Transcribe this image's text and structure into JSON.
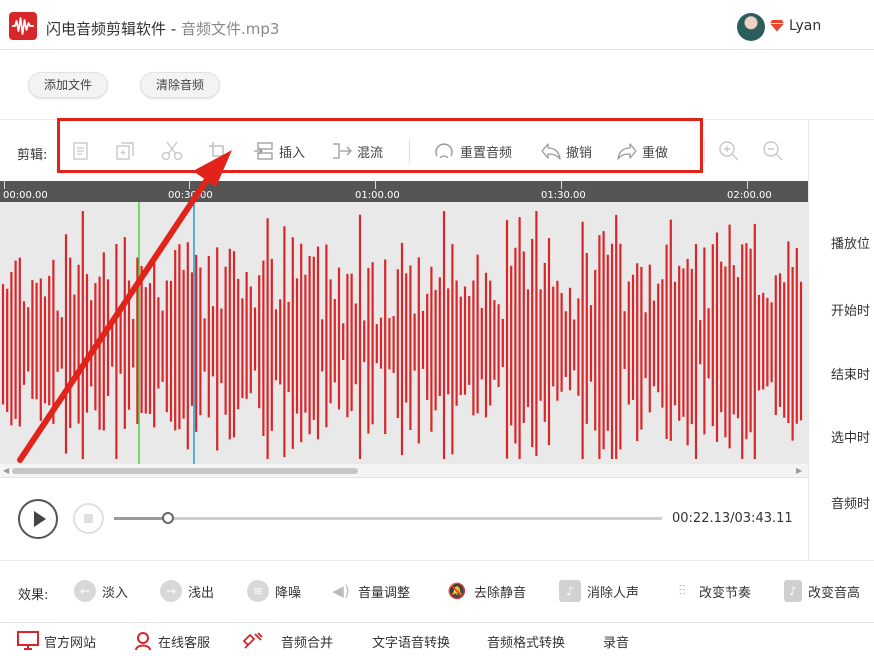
{
  "app": {
    "title": "闪电音频剪辑软件 - ",
    "file_name": "音频文件.mp3",
    "user": "Lyan"
  },
  "file_toolbar": {
    "add_file": "添加文件",
    "clear_audio": "清除音频"
  },
  "edit_toolbar": {
    "label": "剪辑:",
    "insert": "插入",
    "mix": "混流",
    "reset_audio": "重置音频",
    "undo": "撤销",
    "redo": "重做"
  },
  "timeline": {
    "ticks": [
      "00:00.00",
      "00:30.00",
      "01:00.00",
      "01:30.00",
      "02:00.00"
    ]
  },
  "properties": {
    "play_pos": "播放位",
    "start_time": "开始时",
    "end_time": "结束时",
    "selected_time": "选中时",
    "audio_time": "音频时"
  },
  "playback": {
    "time": "00:22.13/03:43.11",
    "progress": 0.099
  },
  "effects": {
    "label": "效果:",
    "fade_in": "淡入",
    "fade_out": "浅出",
    "denoise": "降噪",
    "volume": "音量调整",
    "remove_silence": "去除静音",
    "remove_vocals": "消除人声",
    "change_tempo": "改变节奏",
    "change_pitch": "改变音高"
  },
  "bottom": {
    "website": "官方网站",
    "support": "在线客服",
    "merge": "音频合并",
    "tts": "文字语音转换",
    "format": "音频格式转换",
    "record": "录音"
  },
  "colors": {
    "accent": "#d9262a",
    "waveform": "#d9262a",
    "highlight_box": "#e2231a",
    "selection_start": "#4cd137",
    "playhead": "#1e9fd6"
  }
}
